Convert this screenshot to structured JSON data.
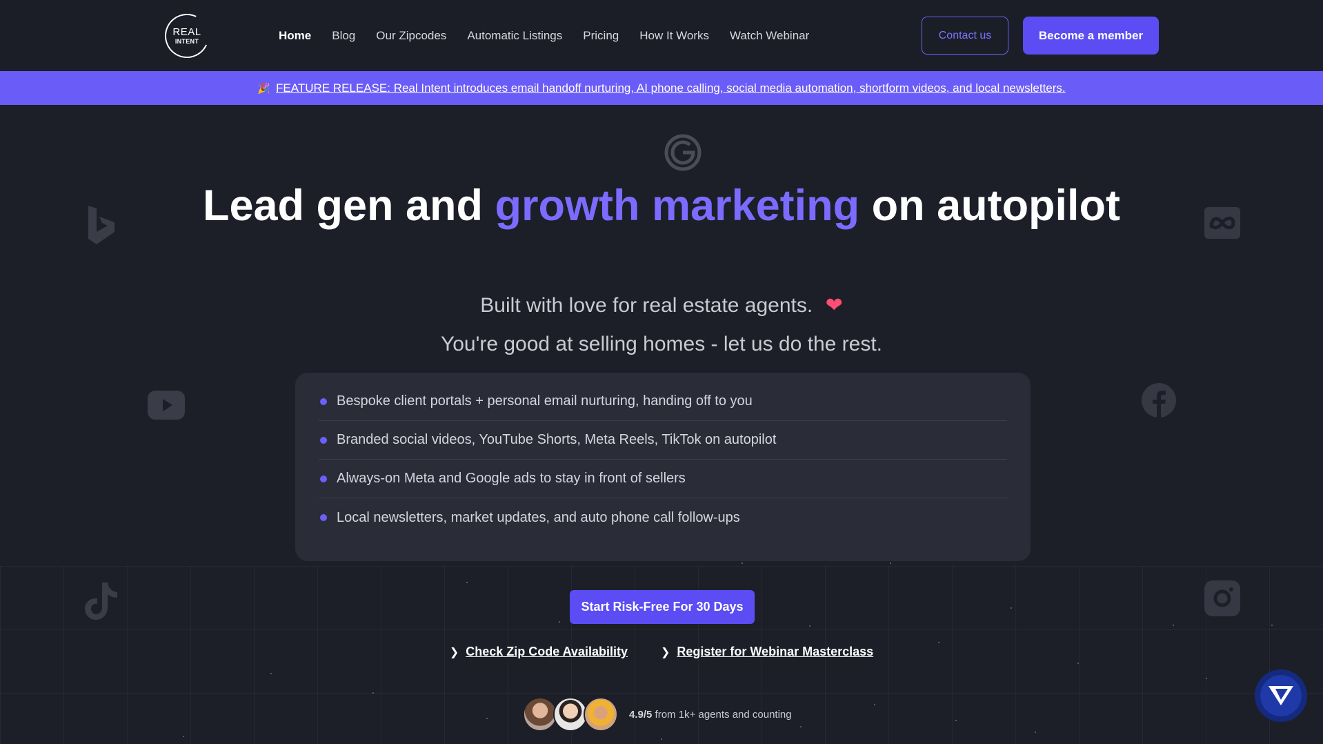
{
  "header": {
    "logo": {
      "line1": "REAL",
      "line2": "INTENT"
    },
    "nav": [
      {
        "label": "Home",
        "active": true
      },
      {
        "label": "Blog"
      },
      {
        "label": "Our Zipcodes"
      },
      {
        "label": "Automatic Listings"
      },
      {
        "label": "Pricing"
      },
      {
        "label": "How It Works"
      },
      {
        "label": "Watch Webinar"
      }
    ],
    "contact_label": "Contact us",
    "member_label": "Become a member"
  },
  "banner": {
    "emoji": "🎉",
    "text": "FEATURE RELEASE: Real Intent introduces email handoff nurturing, AI phone calling, social media automation, shortform videos, and local newsletters."
  },
  "hero": {
    "title_pre": "Lead gen and ",
    "title_accent": "growth marketing",
    "title_post": " on autopilot",
    "subtitle": "Built with love for real estate agents.",
    "subtitle_emoji": "❤",
    "tagline": "You're good at selling homes - let us do the rest."
  },
  "features": [
    "Bespoke client portals + personal email nurturing, handing off to you",
    "Branded social videos, YouTube Shorts, Meta Reels, TikTok on autopilot",
    "Always-on Meta and Google ads to stay in front of sellers",
    "Local newsletters, market updates, and auto phone call follow-ups"
  ],
  "cta": {
    "primary": "Start Risk-Free For 30 Days",
    "link1": "Check Zip Code Availability",
    "link2": "Register for Webinar Masterclass"
  },
  "proof": {
    "rating": "4.9/5",
    "text": "from 1k+ agents and counting"
  },
  "colors": {
    "background": "#1c1f28",
    "accent": "#6a5cf6",
    "card": "#2a2d38"
  },
  "icons": [
    "google-icon",
    "bing-icon",
    "meta-icon",
    "youtube-icon",
    "facebook-icon",
    "tiktok-icon",
    "instagram-icon",
    "chat-widget-icon"
  ]
}
